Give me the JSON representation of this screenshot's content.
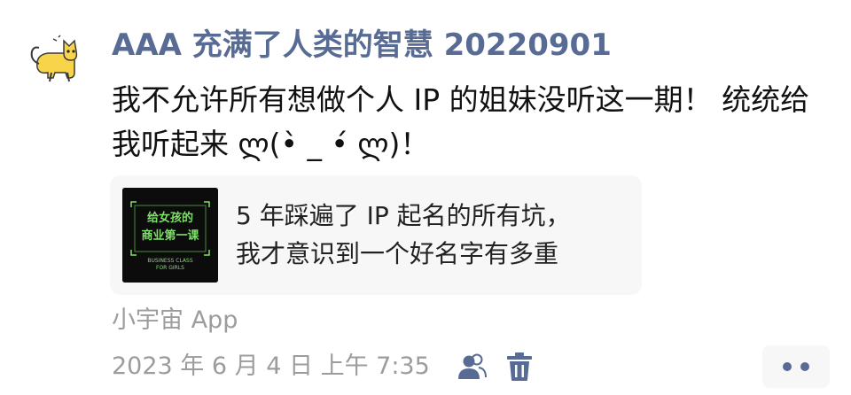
{
  "post": {
    "author": "AAA 充满了人类的智慧 20220901",
    "text": "我不允许所有想做个人 IP 的姐妹没听这一期！ 统统给我听起来 ლ(•̀ _ •́ ლ)！"
  },
  "card": {
    "title": "5 年踩遍了 IP 起名的所有坑，\n我才意识到一个好名字有多重",
    "thumb_line1": "给女孩的",
    "thumb_line2": "商业第一课",
    "thumb_line3": "BUSINESS CLASS",
    "thumb_line4": "FOR GIRLS"
  },
  "meta": {
    "source": "小宇宙 App",
    "time": "2023 年 6 月 4 日 上午 7:35"
  },
  "icons": {
    "avatar": "cat-avatar-icon",
    "visibility": "people-icon",
    "delete": "trash-icon",
    "more": "more-dots-icon"
  },
  "colors": {
    "name": "#576b95",
    "accent_green": "#7ee06a",
    "cat_yellow": "#f7d44a"
  }
}
